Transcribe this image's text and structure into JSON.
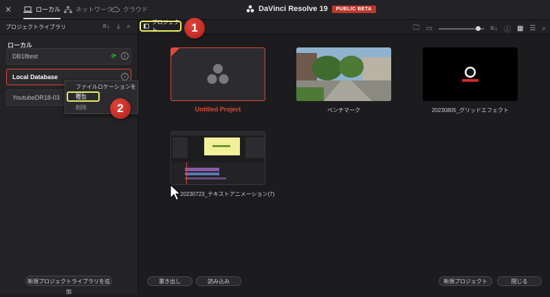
{
  "topbar": {
    "tabs": [
      {
        "label": "ローカル",
        "icon": "laptop-icon"
      },
      {
        "label": "ネットワーク",
        "icon": "network-icon"
      },
      {
        "label": "クラウド",
        "icon": "cloud-icon"
      }
    ],
    "app_title": "DaVinci Resolve 19",
    "badge": "PUBLIC BETA"
  },
  "left_panel": {
    "title": "プロジェクトライブラリ",
    "section": "ローカル",
    "libraries": [
      "DB18test",
      "Local Database",
      "YoutubeDR18-03"
    ],
    "add_button": "新規プロジェクトライブラリを追加"
  },
  "context_menu": {
    "items": [
      "ファイルロケーションを開く",
      "複製",
      "削除"
    ]
  },
  "main": {
    "projects_button": "プロジェクト",
    "projects": [
      {
        "name": "Untitled Project"
      },
      {
        "name": "ベンチマーク"
      },
      {
        "name": "20230805_グリッドエフェクト"
      },
      {
        "name": "20230723_テキストアニメーション(7)"
      }
    ],
    "footer": {
      "export": "書き出し",
      "import": "読み込み",
      "new_project": "新規プロジェクト",
      "close": "閉じる"
    }
  },
  "callouts": [
    "1",
    "2"
  ],
  "colors": {
    "accent_red": "#e04a3a",
    "highlight_yellow": "#f1ee62",
    "sync_green": "#2ecc40"
  }
}
